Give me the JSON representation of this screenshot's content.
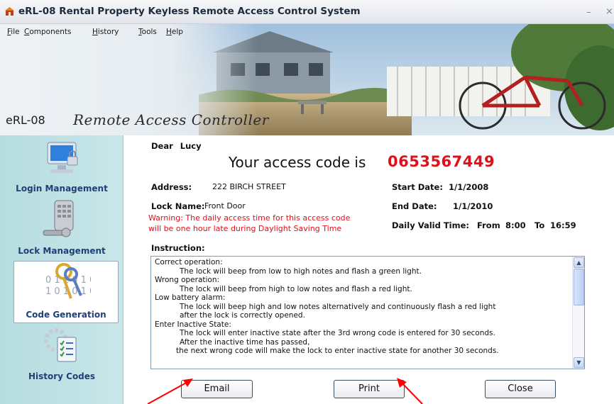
{
  "window": {
    "title": "eRL-08 Rental Property Keyless Remote Access Control System",
    "minimize_glyph": "–",
    "close_glyph": "×"
  },
  "menu": {
    "items": [
      "File",
      "Components",
      "History",
      "Tools",
      "Help"
    ]
  },
  "banner": {
    "logo_text": "eRL-08",
    "script_text": "Remote Access Controller"
  },
  "sidebar": {
    "items": [
      {
        "label": "Login Management",
        "icon": "monitor-lock-icon",
        "active": false
      },
      {
        "label": "Lock Management",
        "icon": "keypad-lock-icon",
        "active": false
      },
      {
        "label": "Code Generation",
        "icon": "keys-binary-icon",
        "active": true
      },
      {
        "label": "History Codes",
        "icon": "gear-checklist-icon",
        "active": false
      }
    ]
  },
  "main": {
    "dear_label": "Dear",
    "recipient": "Lucy",
    "code_intro": "Your access code is",
    "access_code": "0653567449",
    "address_label": "Address:",
    "address_value": "222 BIRCH STREET",
    "start_date_label": "Start Date:",
    "start_date_value": "1/1/2008",
    "lock_name_label": "Lock Name:",
    "lock_name_value": "Front Door",
    "end_date_label": "End Date:",
    "end_date_value": "1/1/2010",
    "warning_line1": "Warning: The daily access time for this access code",
    "warning_line2": "will be one hour late during Daylight Saving Time",
    "daily_valid_label": "Daily Valid Time:",
    "daily_from_label": "From",
    "daily_from_value": "8:00",
    "daily_to_label": "To",
    "daily_to_value": "16:59",
    "instruction_title": "Instruction:",
    "instructions": {
      "l1": "Correct operation:",
      "l2": "The lock will beep from low to high notes and flash a green light.",
      "l3": "Wrong operation:",
      "l4": "The lock will beep from high to low notes and flash a red light.",
      "l5": "Low battery alarm:",
      "l6": "The lock will beep high and low notes alternatively and continuously flash a red light",
      "l7": "after the lock is correctly opened.",
      "l8": "Enter Inactive State:",
      "l9": "The lock will enter inactive state after the 3rd wrong code is entered for 30 seconds.",
      "l10": "After the inactive time has passed,",
      "l11": "the next wrong code will make the lock to enter inactive state for another 30 seconds."
    }
  },
  "buttons": {
    "email": "Email",
    "print": "Print",
    "close": "Close"
  },
  "colors": {
    "code_red": "#e0101a",
    "nav_blue": "#1f3f78",
    "sidebar_teal": "#b6dce0",
    "annotation_arrow": "#ff0000"
  }
}
